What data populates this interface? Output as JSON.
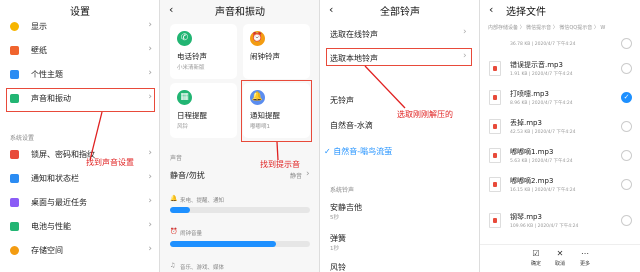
{
  "settings": {
    "title": "设置",
    "items_top": [
      {
        "label": "显示",
        "icon": "sun-icon",
        "color": "#f7b500"
      },
      {
        "label": "壁纸",
        "icon": "wallpaper-icon",
        "color": "#f0642e"
      },
      {
        "label": "个性主题",
        "icon": "theme-icon",
        "color": "#2b8cf3"
      },
      {
        "label": "声音和振动",
        "icon": "sound-icon",
        "color": "#22b573"
      }
    ],
    "section_label": "系统设置",
    "items_bottom": [
      {
        "label": "锁屏、密码和指纹",
        "icon": "lock-icon",
        "color": "#e84a3a"
      },
      {
        "label": "通知和状态栏",
        "icon": "notification-icon",
        "color": "#2b8cf3"
      },
      {
        "label": "桌面与最近任务",
        "icon": "desktop-icon",
        "color": "#8b5cf6"
      },
      {
        "label": "电池与性能",
        "icon": "battery-icon",
        "color": "#22b573"
      },
      {
        "label": "存储空间",
        "icon": "storage-icon",
        "color": "#f39c12"
      }
    ],
    "annotation": "找到声音设置"
  },
  "sound": {
    "title": "声音和振动",
    "cards": [
      {
        "title": "电话铃声",
        "sub": "小米清新版",
        "icon": "phone-icon",
        "color": "#22b573"
      },
      {
        "title": "闹钟铃声",
        "sub": "",
        "icon": "alarm-icon",
        "color": "#f39c12"
      },
      {
        "title": "日程提醒",
        "sub": "风铃",
        "icon": "calendar-icon",
        "color": "#22b573"
      },
      {
        "title": "通知提醒",
        "sub": "嘟嘟嘀1",
        "icon": "bell-icon",
        "color": "#5b8def"
      }
    ],
    "section_label": "声音",
    "mute_label": "静音/勿扰",
    "mute_value": "静音",
    "volumes": [
      {
        "label": "来电、提醒、通知",
        "icon": "ring-icon",
        "value": 0.14
      },
      {
        "label": "闹钟音量",
        "icon": "clock-icon",
        "value": 0.76
      },
      {
        "label": "音乐、游戏、媒体",
        "icon": "music-icon",
        "value": 0.4
      }
    ],
    "annotation": "找到提示音"
  },
  "ringtones": {
    "title": "全部铃声",
    "online": "选取在线铃声",
    "local": "选取本地铃声",
    "none": "无铃声",
    "nature": "自然音-水滴",
    "selected": "✓ 自然音-嗡鸟流萤",
    "section_label": "系统铃声",
    "list": [
      {
        "name": "安静吉他",
        "sub": "5秒"
      },
      {
        "name": "弹簧",
        "sub": "1秒"
      },
      {
        "name": "风铃",
        "sub": ""
      }
    ],
    "annotation": "选取刚刚解压的"
  },
  "files": {
    "title": "选择文件",
    "path": "内部存储设备 〉 微信提示音 〉 微信QQ提示音 〉 W",
    "items": [
      {
        "name": "",
        "meta": "36.78 KB | 2020/4/7 下午4:24",
        "checked": false
      },
      {
        "name": "错误提示音.mp3",
        "meta": "1.91 KB | 2020/4/7 下午4:24",
        "checked": false
      },
      {
        "name": "打喷嚏.mp3",
        "meta": "8.96 KB | 2020/4/7 下午4:24",
        "checked": true
      },
      {
        "name": "丢掉.mp3",
        "meta": "42.53 KB | 2020/4/7 下午4:24",
        "checked": false
      },
      {
        "name": "嘟嘟嘀1.mp3",
        "meta": "5.63 KB | 2020/4/7 下午4:24",
        "checked": false
      },
      {
        "name": "嘟嘟嘀2.mp3",
        "meta": "16.15 KB | 2020/4/7 下午4:24",
        "checked": false
      },
      {
        "name": "钢琴.mp3",
        "meta": "109.96 KB | 2020/4/7 下午4:24",
        "checked": false
      }
    ],
    "bottom": [
      {
        "label": "确定",
        "icon": "confirm-icon"
      },
      {
        "label": "取消",
        "icon": "cancel-icon"
      },
      {
        "label": "更多",
        "icon": "more-icon"
      }
    ]
  },
  "colors": {
    "accent": "#1e90ff",
    "annotation": "#e02020",
    "highlight": "#e84a3a"
  }
}
